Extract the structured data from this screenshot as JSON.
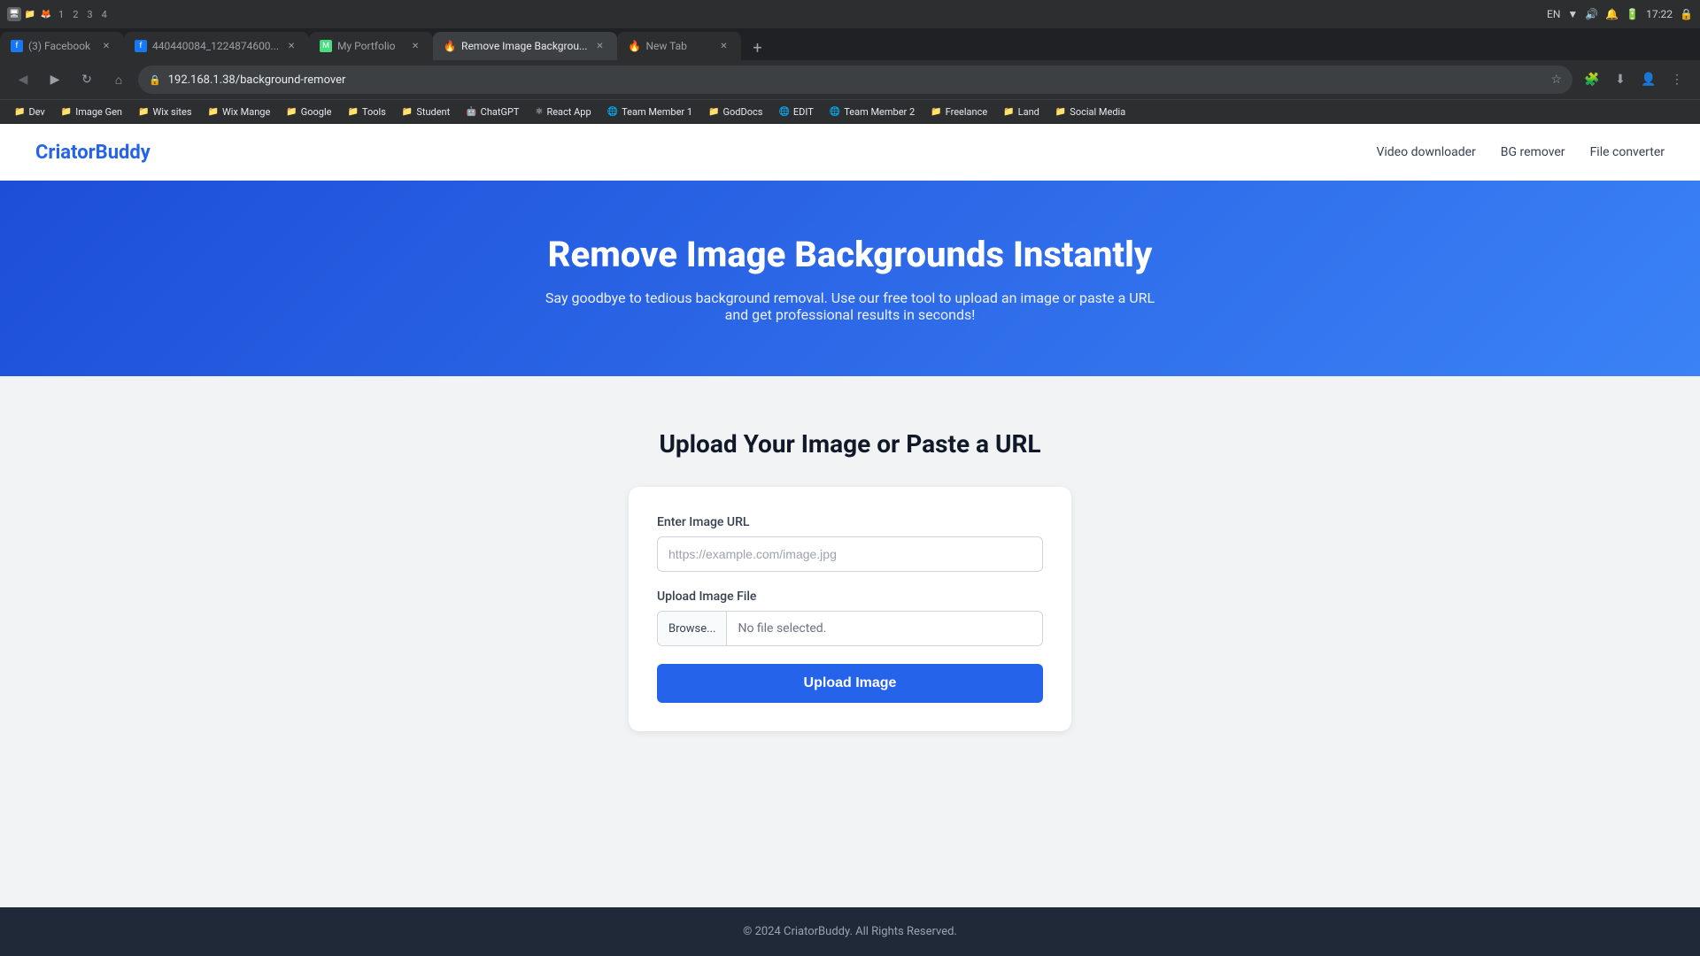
{
  "browser": {
    "tabs": [
      {
        "id": "facebook",
        "title": "(3) Facebook",
        "favicon_color": "#1877f2",
        "favicon_text": "f",
        "active": false
      },
      {
        "id": "img440",
        "title": "440440084_12248746...",
        "favicon_color": "#1877f2",
        "favicon_text": "f",
        "active": false
      },
      {
        "id": "portfolio",
        "title": "My Portfolio",
        "favicon_color": "#4ade80",
        "favicon_text": "M",
        "active": false
      },
      {
        "id": "bg-remover",
        "title": "Remove Image Backgrou...",
        "favicon_color": "#f97316",
        "favicon_text": "🔥",
        "active": true
      },
      {
        "id": "new-tab",
        "title": "New Tab",
        "favicon_color": "#f97316",
        "favicon_text": "🔥",
        "active": false
      }
    ],
    "address": "192.168.1.38/background-remover",
    "new_tab_label": "+"
  },
  "bookmarks": [
    {
      "label": "Dev"
    },
    {
      "label": "Image Gen"
    },
    {
      "label": "Wix sites"
    },
    {
      "label": "Wix Mange"
    },
    {
      "label": "Google"
    },
    {
      "label": "Tools"
    },
    {
      "label": "Student"
    },
    {
      "label": "ChatGPT"
    },
    {
      "label": "React App"
    },
    {
      "label": "Team Member 1"
    },
    {
      "label": "GodDocs"
    },
    {
      "label": "EDIT"
    },
    {
      "label": "Team Member 2"
    },
    {
      "label": "Freelance"
    },
    {
      "label": "Land"
    },
    {
      "label": "Social Media"
    }
  ],
  "nav": {
    "logo": "CriatorBuddy",
    "links": [
      {
        "label": "Video downloader"
      },
      {
        "label": "BG remover"
      },
      {
        "label": "File converter"
      }
    ]
  },
  "hero": {
    "title": "Remove Image Backgrounds Instantly",
    "subtitle": "Say goodbye to tedious background removal. Use our free tool to upload an image or paste a URL and get professional results in seconds!"
  },
  "main": {
    "section_title": "Upload Your Image or Paste a URL",
    "card": {
      "url_label": "Enter Image URL",
      "url_placeholder": "https://example.com/image.jpg",
      "file_label": "Upload Image File",
      "browse_label": "Browse...",
      "file_name": "No file selected.",
      "upload_button": "Upload Image"
    }
  },
  "footer": {
    "text": "© 2024 CriatorBuddy. All Rights Reserved."
  }
}
